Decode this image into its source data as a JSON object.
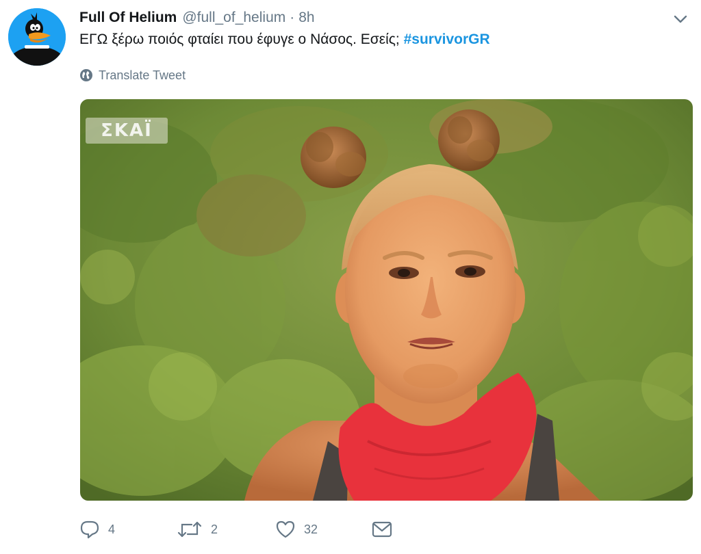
{
  "tweet": {
    "display_name": "Full Of Helium",
    "handle": "@full_of_helium",
    "separator": "·",
    "time": "8h",
    "text": "ΕΓΩ ξέρω ποιός φταίει που έφυγε ο Νάσος. Εσείς; ",
    "hashtag": "#survivorGR",
    "translate_label": "Translate Tweet",
    "media_watermark": "ΣΚΑΪ"
  },
  "actions": {
    "reply_count": "4",
    "retweet_count": "2",
    "like_count": "32"
  },
  "icons": {
    "avatar": "daffy-duck-avatar",
    "caret": "chevron-down-icon",
    "translate": "globe-icon",
    "reply": "reply-icon",
    "retweet": "retweet-icon",
    "like": "heart-icon",
    "message": "envelope-icon"
  },
  "colors": {
    "link": "#1b95e0",
    "secondary": "#657786",
    "text": "#14171a",
    "avatar_bg": "#1da1f2"
  }
}
